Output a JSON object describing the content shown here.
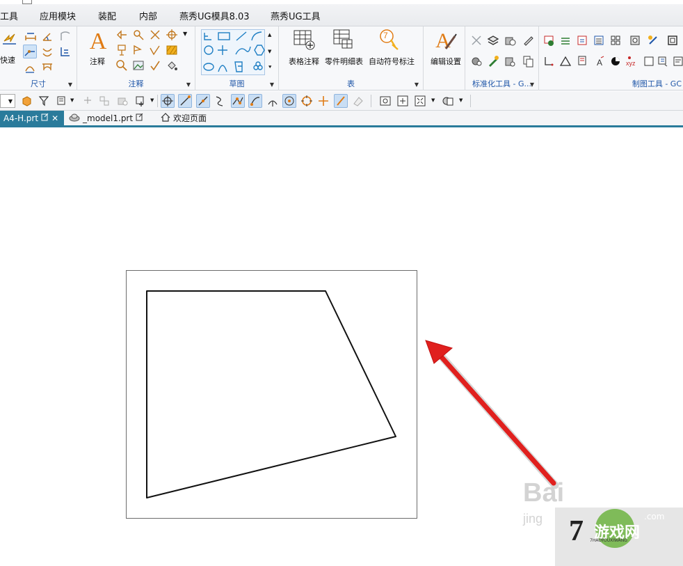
{
  "menu": {
    "items": [
      "工具",
      "应用模块",
      "装配",
      "内部",
      "燕秀UG模具8.03",
      "燕秀UG工具"
    ]
  },
  "ribbon": {
    "dimension": {
      "label": "尺寸",
      "quick_label": "快速"
    },
    "annotation": {
      "label": "注释",
      "note_label": "注释"
    },
    "sketch": {
      "label": "草图"
    },
    "table": {
      "label": "表",
      "tabular_note_label": "表格注释",
      "parts_list_label": "零件明细表",
      "auto_balloon_label": "自动符号标注",
      "balloon_number": "7"
    },
    "edit_settings_label": "编辑设置",
    "standard_tools_label": "标准化工具 - G...",
    "drafting_tools_label": "制图工具 - GC"
  },
  "tabs": [
    {
      "label": "A4-H.prt"
    },
    {
      "label": "_model1.prt"
    },
    {
      "label": "欢迎页面"
    }
  ],
  "drawing": {
    "sheet_name": "A4-H"
  },
  "watermark": {
    "baidu_text": "Bai",
    "jingyan_text": "jing",
    "site_text": "游戏网",
    "site_small": "7HAOYOUXIWANG",
    "com_text": ".com",
    "number": "7"
  },
  "colors": {
    "accent": "#2a7b9b",
    "group_label": "#1f56a8",
    "arrow": "#e0201e",
    "selected": "#cfe3f7"
  }
}
